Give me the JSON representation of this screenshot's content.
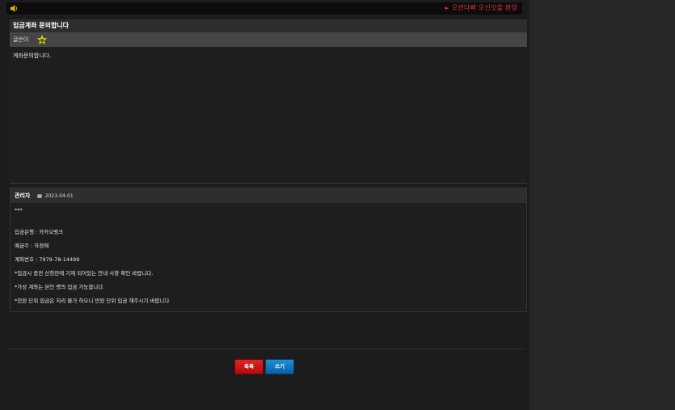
{
  "topbar": {
    "ticker": "오관다빠 오신것을 환영"
  },
  "post": {
    "title": "입금계좌 문의합니다",
    "author": "글쓴이",
    "body": "계좌문의합니다."
  },
  "reply": {
    "author": "관리자",
    "date": "2023-04-01",
    "lines": [
      "***",
      "입금은행 : 카카오뱅크",
      "예금주 : 하정애",
      "계좌번호 : 7979-78-14499",
      "*입금시 충전 신청란에 기재 되어있는 안내 사항 확인 바랍니다.",
      "*가상 계좌는 본인 명의 입금 가능합니다.",
      "*천원 단위 입금은 처리 불가 하오니 만원 단위 입금 해주시기 바랍니다"
    ]
  },
  "buttons": {
    "list_label": "목록",
    "write_label": "쓰기"
  },
  "colors": {
    "ticker": "#e03030",
    "list_button": "#d01515",
    "write_button": "#1477c4"
  }
}
